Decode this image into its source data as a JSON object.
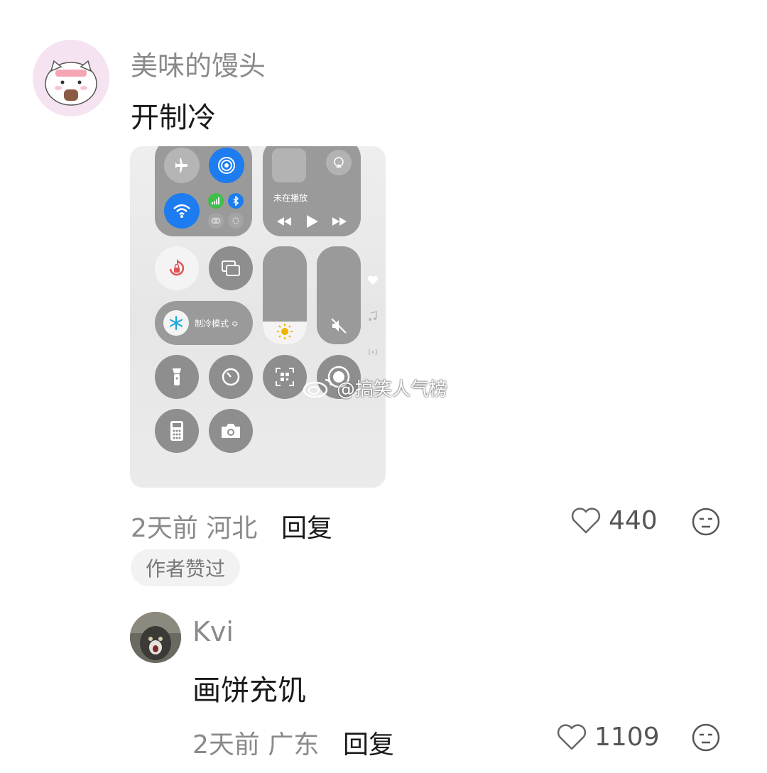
{
  "comment": {
    "username": "美味的馒头",
    "text": "开制冷",
    "time": "2天前",
    "location": "河北",
    "reply_label": "回复",
    "likes": "440",
    "author_badge": "作者赞过",
    "screenshot": {
      "now_playing": "未在播放",
      "mode_label": "制冷模式 ≎"
    },
    "watermark": "@搞笑人气榜"
  },
  "reply": {
    "username": "Kvi",
    "text": "画饼充饥",
    "time": "2天前",
    "location": "广东",
    "reply_label": "回复",
    "likes": "1109"
  },
  "colors": {
    "accent_blue": "#1c7cf0",
    "text_gray": "#8a8a8a"
  }
}
